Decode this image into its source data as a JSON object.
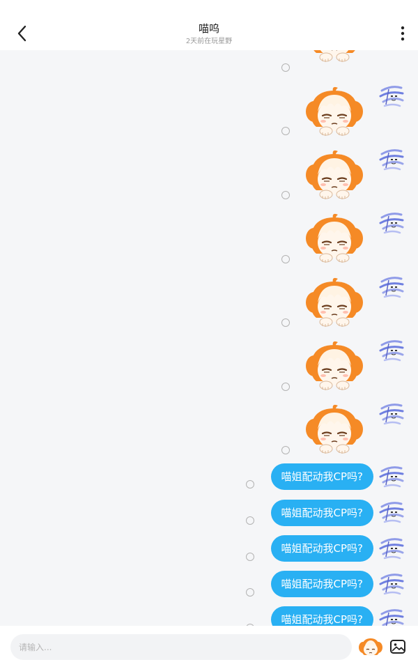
{
  "header": {
    "title": "喵呜",
    "subtitle": "2天前在玩星野",
    "back_icon": "chevron-left-icon",
    "more_icon": "more-vertical-icon"
  },
  "colors": {
    "bubble": "#29b0f3",
    "background": "#f5f6f8",
    "sticker_hair": "#f58a26"
  },
  "messages": [
    {
      "type": "sticker",
      "sticker": "sleepy-girl-sticker"
    },
    {
      "type": "sticker",
      "sticker": "sleepy-girl-sticker"
    },
    {
      "type": "sticker",
      "sticker": "sleepy-girl-sticker"
    },
    {
      "type": "sticker",
      "sticker": "sleepy-girl-sticker"
    },
    {
      "type": "sticker",
      "sticker": "sleepy-girl-sticker"
    },
    {
      "type": "sticker",
      "sticker": "sleepy-girl-sticker"
    },
    {
      "type": "sticker",
      "sticker": "sleepy-girl-sticker"
    },
    {
      "type": "text",
      "text": "喵姐配动我CP吗?"
    },
    {
      "type": "text",
      "text": "喵姐配动我CP吗?"
    },
    {
      "type": "text",
      "text": "喵姐配动我CP吗?"
    },
    {
      "type": "text",
      "text": "喵姐配动我CP吗?"
    },
    {
      "type": "text",
      "text": "喵姐配动我CP吗?"
    }
  ],
  "input": {
    "placeholder": "请输入...",
    "value": "",
    "emoji_icon": "sticker-face-icon",
    "image_icon": "image-icon"
  }
}
